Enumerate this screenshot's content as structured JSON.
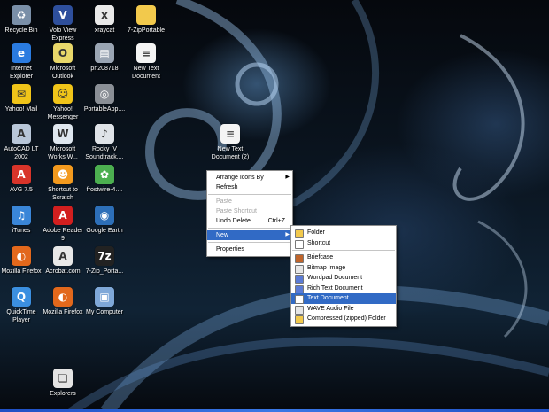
{
  "desktop": {
    "icons": [
      {
        "label": "Recycle Bin",
        "icon": "recycle-bin-icon",
        "color": "#7a8fa8",
        "glyph": "♻"
      },
      {
        "label": "Volo View Express",
        "icon": "volo-view-icon",
        "color": "#2e4f9c",
        "glyph": "V"
      },
      {
        "label": "xraycat",
        "icon": "xraycat-icon",
        "color": "#e9e9e9",
        "glyph": "x"
      },
      {
        "label": "7-ZipPortable",
        "icon": "folder-icon",
        "color": "#f2c94c",
        "glyph": ""
      },
      {
        "label": "Internet Explorer",
        "icon": "internet-explorer-icon",
        "color": "#2a7be0",
        "glyph": "e"
      },
      {
        "label": "Microsoft Outlook",
        "icon": "outlook-icon",
        "color": "#e8d76a",
        "glyph": "O"
      },
      {
        "label": "pn208718",
        "icon": "image-file-icon",
        "color": "#9aa5b3",
        "glyph": "▤"
      },
      {
        "label": "New Text Document",
        "icon": "text-document-icon",
        "color": "#f4f4f4",
        "glyph": "≡"
      },
      {
        "label": "Yahoo! Mail",
        "icon": "yahoo-mail-icon",
        "color": "#f0c419",
        "glyph": "✉"
      },
      {
        "label": "Yahoo! Messenger",
        "icon": "yahoo-messenger-icon",
        "color": "#f0c419",
        "glyph": "☺"
      },
      {
        "label": "PortableApp....",
        "icon": "portableapps-icon",
        "color": "#8a8f96",
        "glyph": "◎"
      },
      {
        "label": "AutoCAD LT 2002",
        "icon": "autocad-icon",
        "color": "#b8c6d8",
        "glyph": "A"
      },
      {
        "label": "Microsoft Works W...",
        "icon": "works-icon",
        "color": "#dfe7ef",
        "glyph": "W"
      },
      {
        "label": "Rocky IV Soundtrack....",
        "icon": "soundtrack-icon",
        "color": "#dfe3e8",
        "glyph": "♪"
      },
      {
        "label": "AVG 7.5",
        "icon": "avg-icon",
        "color": "#d8342a",
        "glyph": "A"
      },
      {
        "label": "Shortcut to Scratch",
        "icon": "scratch-icon",
        "color": "#f39a1e",
        "glyph": "☻"
      },
      {
        "label": "frostwire-4....",
        "icon": "frostwire-icon",
        "color": "#4caf50",
        "glyph": "✿"
      },
      {
        "label": "iTunes",
        "icon": "itunes-icon",
        "color": "#3a86d8",
        "glyph": "♫"
      },
      {
        "label": "Adobe Reader 9",
        "icon": "adobe-reader-icon",
        "color": "#d21f1f",
        "glyph": "A"
      },
      {
        "label": "Google Earth",
        "icon": "google-earth-icon",
        "color": "#2d6fb8",
        "glyph": "◉"
      },
      {
        "label": "Mozilla Firefox",
        "icon": "firefox-icon",
        "color": "#e2681c",
        "glyph": "◐"
      },
      {
        "label": "Acrobat.com",
        "icon": "acrobat-icon",
        "color": "#e8e8e8",
        "glyph": "A"
      },
      {
        "label": "7-Zip_Porta...",
        "icon": "7zip-icon",
        "color": "#222222",
        "glyph": "7z"
      },
      {
        "label": "QuickTime Player",
        "icon": "quicktime-icon",
        "color": "#3b8fe0",
        "glyph": "Q"
      },
      {
        "label": "Mozilla Firefox",
        "icon": "firefox-icon",
        "color": "#e2681c",
        "glyph": "◐"
      },
      {
        "label": "My Computer",
        "icon": "my-computer-icon",
        "color": "#7fa8d8",
        "glyph": "▣"
      },
      {
        "label": "Explorers",
        "icon": "explorers-icon",
        "color": "#e4e4e4",
        "glyph": "❏"
      }
    ],
    "new_doc_label": "New Text Document (2)"
  },
  "context_menu": {
    "items": [
      {
        "label": "Arrange Icons By",
        "submenu": true
      },
      {
        "label": "Refresh"
      },
      {
        "sep": true
      },
      {
        "label": "Paste",
        "disabled": true
      },
      {
        "label": "Paste Shortcut",
        "disabled": true
      },
      {
        "label": "Undo Delete",
        "accel": "Ctrl+Z"
      },
      {
        "sep": true
      },
      {
        "label": "New",
        "submenu": true,
        "highlight": true
      },
      {
        "sep": true
      },
      {
        "label": "Properties"
      }
    ]
  },
  "new_submenu": {
    "items": [
      {
        "label": "Folder",
        "icon": "folder-icon",
        "color": "#f2c94c"
      },
      {
        "label": "Shortcut",
        "icon": "shortcut-icon",
        "color": "#ffffff"
      },
      {
        "sep": true
      },
      {
        "label": "Briefcase",
        "icon": "briefcase-icon",
        "color": "#c0652b"
      },
      {
        "label": "Bitmap Image",
        "icon": "bitmap-icon",
        "color": "#e7e7e7"
      },
      {
        "label": "Wordpad Document",
        "icon": "wordpad-icon",
        "color": "#5b7bd5"
      },
      {
        "label": "Rich Text Document",
        "icon": "rich-text-icon",
        "color": "#5b7bd5"
      },
      {
        "label": "Text Document",
        "icon": "text-document-icon",
        "color": "#ffffff",
        "highlight": true
      },
      {
        "label": "WAVE Audio File",
        "icon": "wave-audio-icon",
        "color": "#e6e6e6"
      },
      {
        "label": "Compressed (zipped) Folder",
        "icon": "zip-folder-icon",
        "color": "#f2c94c"
      }
    ]
  }
}
